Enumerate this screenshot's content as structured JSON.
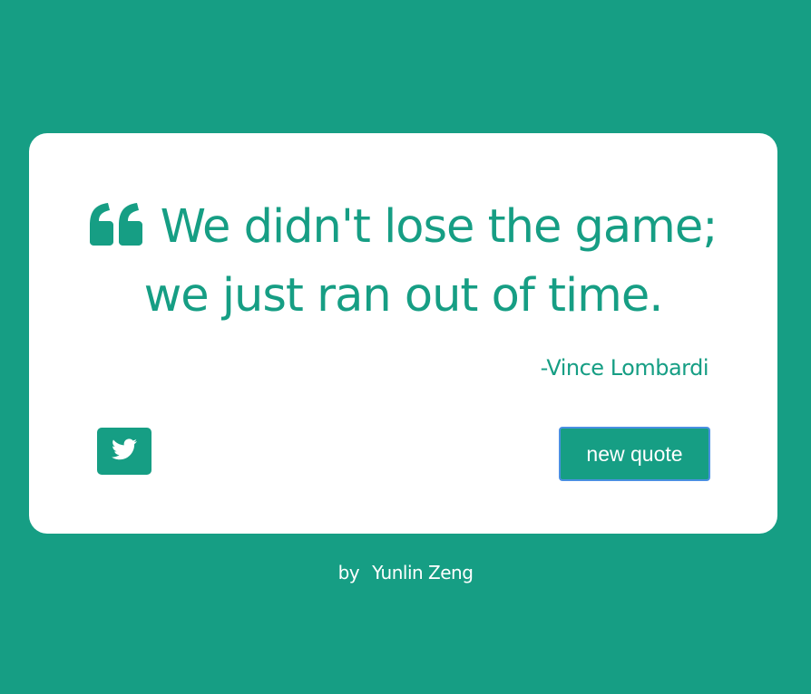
{
  "colors": {
    "background": "#169e84",
    "card": "#ffffff",
    "accent": "#169e84",
    "button_focus_border": "#4a90e2"
  },
  "quote": {
    "icon": "quote-left-icon",
    "line1": "We didn't lose the game;",
    "line2": "we just ran out of time.",
    "author": "-Vince Lombardi"
  },
  "actions": {
    "tweet_icon": "twitter-icon",
    "new_quote_label": "new quote"
  },
  "footer": {
    "by": "by",
    "name": "Yunlin Zeng"
  }
}
